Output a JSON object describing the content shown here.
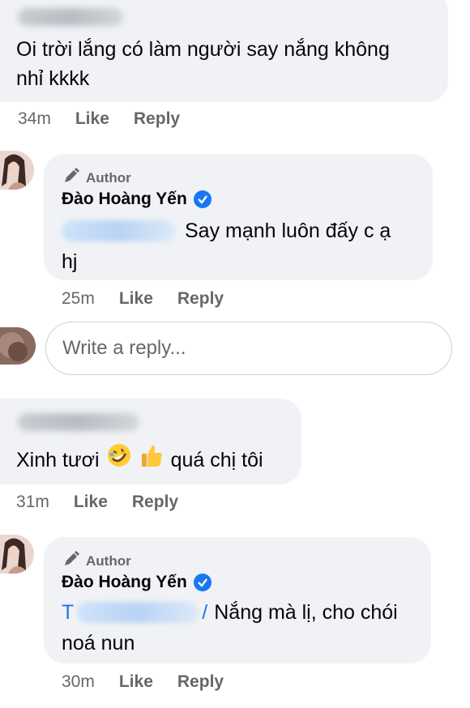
{
  "colors": {
    "bubble": "#f0f2f5",
    "link": "#1877f2",
    "meta": "#65676b",
    "text": "#050505"
  },
  "comments": [
    {
      "text": "Oi trời lắng có làm người say nắng không nhỉ kkkk",
      "line1": "Oi trời lắng có làm người say nắng không",
      "line2": "nhỉ kkkk",
      "time": "34m",
      "like": "Like",
      "reply": "Reply"
    },
    {
      "author_badge": "Author",
      "name": "Đào Hoàng Yến",
      "line1": "Say mạnh luôn đấy c ạ",
      "line2": "hj",
      "time": "25m",
      "like": "Like",
      "reply": "Reply"
    },
    {
      "text_before": "Xinh tươi",
      "text_after": "quá chị tôi",
      "emojis": [
        "rolling-laughing-emoji",
        "thumbs-up-emoji"
      ],
      "time": "31m",
      "like": "Like",
      "reply": "Reply"
    },
    {
      "author_badge": "Author",
      "name": "Đào Hoàng Yến",
      "mention_start": "T",
      "mention_end": "/",
      "line1": "Nắng mà lị, cho chói",
      "line2": "noá nun",
      "time": "30m",
      "like": "Like",
      "reply": "Reply"
    }
  ],
  "reply_input": {
    "placeholder": "Write a reply..."
  }
}
